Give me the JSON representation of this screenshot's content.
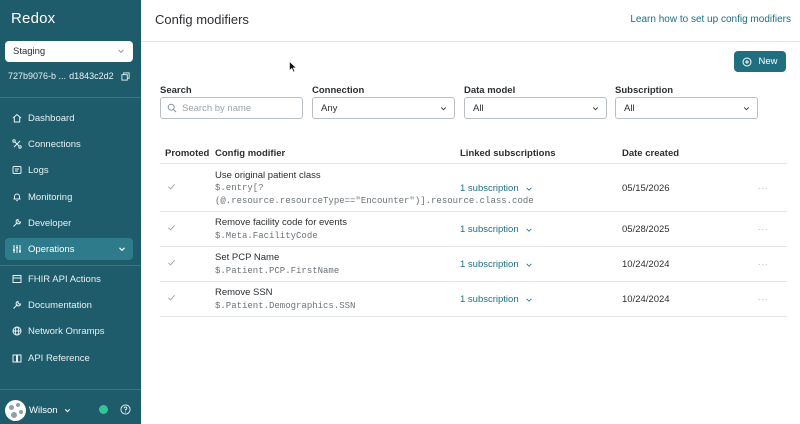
{
  "sidebar": {
    "logo": "Redox",
    "environment": "Staging",
    "org_id": "727b9076-b ...",
    "env_id": "d1843c2d2",
    "nav": [
      {
        "label": "Dashboard",
        "icon": "home-icon"
      },
      {
        "label": "Connections",
        "icon": "connections-icon"
      },
      {
        "label": "Logs",
        "icon": "logs-icon"
      },
      {
        "label": "Monitoring",
        "icon": "bell-icon"
      },
      {
        "label": "Developer",
        "icon": "wrench-icon"
      },
      {
        "label": "Operations",
        "icon": "sliders-icon",
        "active": true
      }
    ],
    "nav2": [
      {
        "label": "FHIR API Actions",
        "icon": "fhir-icon"
      },
      {
        "label": "Documentation",
        "icon": "wrench-icon"
      },
      {
        "label": "Network Onramps",
        "icon": "globe-icon"
      },
      {
        "label": "API Reference",
        "icon": "book-icon"
      }
    ],
    "user_name": "Wilson",
    "status_color": "#35c494"
  },
  "header": {
    "title": "Config modifiers",
    "help_link": "Learn how to set up config modifiers",
    "new_button": "New"
  },
  "filters": {
    "search_label": "Search",
    "search_placeholder": "Search by name",
    "connection_label": "Connection",
    "connection_value": "Any",
    "data_model_label": "Data model",
    "data_model_value": "All",
    "subscription_label": "Subscription",
    "subscription_value": "All"
  },
  "table": {
    "headers": [
      "Promoted",
      "Config modifier",
      "Linked subscriptions",
      "Date created"
    ],
    "rows": [
      {
        "name": "Use original patient class",
        "code": "$.entry[?\n(@.resource.resourceType==\"Encounter\")].resource.class.code",
        "subscriptions": "1 subscription",
        "date": "05/15/2026",
        "more": "..."
      },
      {
        "name": "Remove facility code for events",
        "code": "$.Meta.FacilityCode",
        "subscriptions": "1 subscription",
        "date": "05/28/2025",
        "more": "..."
      },
      {
        "name": "Set PCP Name",
        "code": "$.Patient.PCP.FirstName",
        "subscriptions": "1 subscription",
        "date": "10/24/2024",
        "more": "..."
      },
      {
        "name": "Remove SSN",
        "code": "$.Patient.Demographics.SSN",
        "subscriptions": "1 subscription",
        "date": "10/24/2024",
        "more": "..."
      }
    ]
  },
  "colors": {
    "sidebar_bg": "#1f5c6b",
    "accent": "#1f6f80"
  }
}
